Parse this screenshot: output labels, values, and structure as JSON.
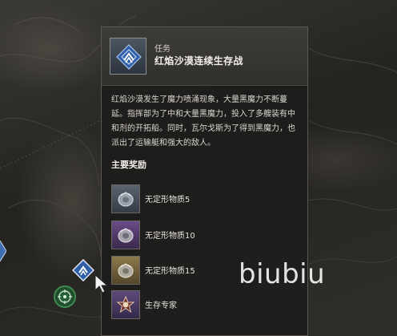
{
  "panel": {
    "category": "任务",
    "title": "红焰沙漠连续生存战",
    "icon": "mission-diamond-icon",
    "description": "红焰沙漠发生了魔力喷涌现象，大量黑魔力不断蔓延。指挥部为了中和大量黑魔力，投入了多艘装有中和剂的开拓船。同时，瓦尔戈斯为了得到黑魔力，也派出了运输艇和强大的敌人。",
    "rewards_title": "主要奖励",
    "rewards": [
      {
        "label": "无定形物质5",
        "icon": "amorphous-material-icon",
        "rarity_color": "#5b6472"
      },
      {
        "label": "无定形物质10",
        "icon": "amorphous-material-icon",
        "rarity_color": "#6a4c86"
      },
      {
        "label": "无定形物质15",
        "icon": "amorphous-material-icon",
        "rarity_color": "#8d7a4d"
      },
      {
        "label": "生存专家",
        "icon": "survival-expert-badge-icon",
        "rarity_color": "#5d4a7b"
      }
    ]
  },
  "map": {
    "marker_icon": "mission-diamond-icon",
    "compass_icon": "target-compass-icon"
  },
  "watermark": "biubiu",
  "colors": {
    "panel_bg": "#1e1d1c",
    "mission_blue": "#3f6fb3",
    "compass_green": "#2f6e3f"
  }
}
